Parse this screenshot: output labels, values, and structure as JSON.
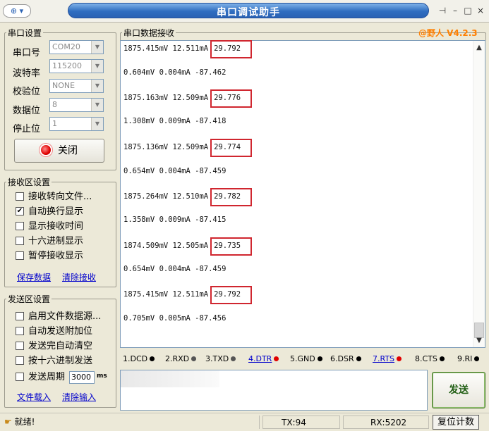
{
  "window": {
    "title": "串口调试助手",
    "sysmenu_icon": "app-menu-icon",
    "controls": [
      "pin",
      "minimize",
      "maximize",
      "close"
    ]
  },
  "version_label": "@野人 V4.2.3",
  "serial_settings": {
    "title": "串口设置",
    "port_label": "串口号",
    "port_value": "COM20",
    "baud_label": "波特率",
    "baud_value": "115200",
    "parity_label": "校验位",
    "parity_value": "NONE",
    "databits_label": "数据位",
    "databits_value": "8",
    "stopbits_label": "停止位",
    "stopbits_value": "1",
    "close_label": "关闭"
  },
  "receive_settings": {
    "title": "接收区设置",
    "options": [
      {
        "label": "接收转向文件...",
        "checked": false
      },
      {
        "label": "自动换行显示",
        "checked": true
      },
      {
        "label": "显示接收时间",
        "checked": false
      },
      {
        "label": "十六进制显示",
        "checked": false
      },
      {
        "label": "暂停接收显示",
        "checked": false
      }
    ],
    "save_link": "保存数据",
    "clear_link": "清除接收"
  },
  "send_settings": {
    "title": "发送区设置",
    "options": [
      {
        "label": "启用文件数据源...",
        "checked": false
      },
      {
        "label": "自动发送附加位",
        "checked": false
      },
      {
        "label": "发送完自动清空",
        "checked": false
      },
      {
        "label": "按十六进制发送",
        "checked": false
      }
    ],
    "period_label": "发送周期",
    "period_value": "3000",
    "period_unit": "ms",
    "load_link": "文件载入",
    "clear_link": "清除输入"
  },
  "receive_panel": {
    "title": "串口数据接收",
    "lines": [
      {
        "prefix": "1875.415mV 12.511mA",
        "temp": "29.792",
        "highlight": true
      },
      {
        "prefix": "0.604mV 0.004mA -87.462",
        "temp": "",
        "highlight": false
      },
      {
        "prefix": "1875.163mV 12.509mA",
        "temp": "29.776",
        "highlight": true
      },
      {
        "prefix": "1.308mV 0.009mA -87.418",
        "temp": "",
        "highlight": false
      },
      {
        "prefix": "1875.136mV 12.509mA",
        "temp": "29.774",
        "highlight": true
      },
      {
        "prefix": "0.654mV 0.004mA -87.459",
        "temp": "",
        "highlight": false
      },
      {
        "prefix": "1875.264mV 12.510mA",
        "temp": "29.782",
        "highlight": true
      },
      {
        "prefix": "1.358mV 0.009mA -87.415",
        "temp": "",
        "highlight": false
      },
      {
        "prefix": "1874.509mV 12.505mA",
        "temp": "29.735",
        "highlight": true
      },
      {
        "prefix": "0.654mV 0.004mA -87.459",
        "temp": "",
        "highlight": false
      },
      {
        "prefix": "1875.415mV 12.511mA",
        "temp": "29.792",
        "highlight": true
      },
      {
        "prefix": "0.705mV 0.005mA -87.456",
        "temp": "",
        "highlight": false
      }
    ],
    "highlight_color": "#d0262f"
  },
  "signals": [
    {
      "label": "1.DCD",
      "color": "#000000",
      "link": false
    },
    {
      "label": "2.RXD",
      "color": "#555555",
      "link": false
    },
    {
      "label": "3.TXD",
      "color": "#555555",
      "link": false
    },
    {
      "label": "4.DTR",
      "color": "#e00000",
      "link": true
    },
    {
      "label": "5.GND",
      "color": "#000000",
      "link": false
    },
    {
      "label": "6.DSR",
      "color": "#000000",
      "link": false
    },
    {
      "label": "7.RTS",
      "color": "#e00000",
      "link": true
    },
    {
      "label": "8.CTS",
      "color": "#000000",
      "link": false
    },
    {
      "label": "9.RI",
      "color": "#000000",
      "link": false
    }
  ],
  "send_button": "发送",
  "statusbar": {
    "state": "就绪!",
    "tx": "TX:94",
    "rx": "RX:5202",
    "reset": "复位计数"
  }
}
